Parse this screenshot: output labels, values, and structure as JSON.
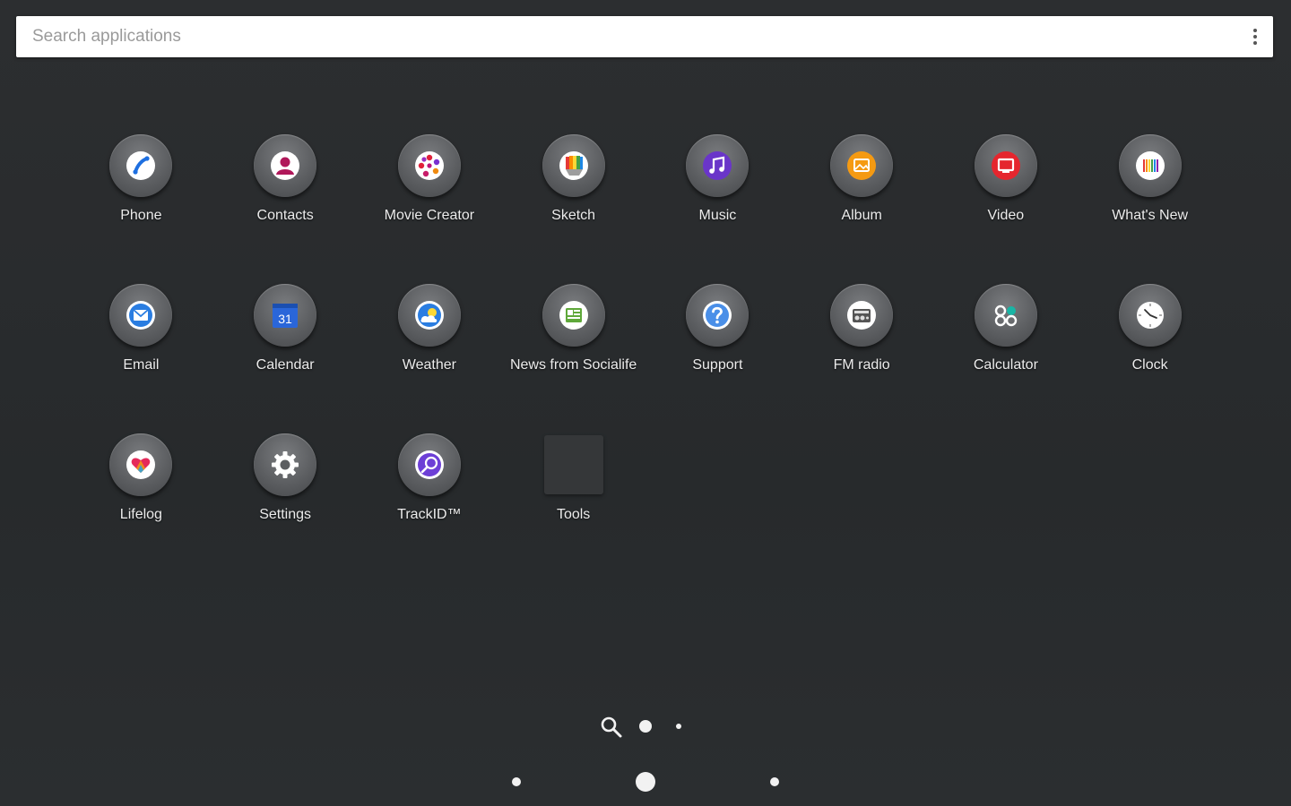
{
  "search": {
    "placeholder": "Search applications"
  },
  "apps": [
    {
      "label": "Phone",
      "icon": "phone-icon"
    },
    {
      "label": "Contacts",
      "icon": "contacts-icon"
    },
    {
      "label": "Movie Creator",
      "icon": "movie-creator-icon"
    },
    {
      "label": "Sketch",
      "icon": "sketch-icon"
    },
    {
      "label": "Music",
      "icon": "music-icon"
    },
    {
      "label": "Album",
      "icon": "album-icon"
    },
    {
      "label": "Video",
      "icon": "video-icon"
    },
    {
      "label": "What's New",
      "icon": "whats-new-icon"
    },
    {
      "label": "Email",
      "icon": "email-icon"
    },
    {
      "label": "Calendar",
      "icon": "calendar-icon",
      "date": "31"
    },
    {
      "label": "Weather",
      "icon": "weather-icon"
    },
    {
      "label": "News from Socialife",
      "icon": "news-icon"
    },
    {
      "label": "Support",
      "icon": "support-icon"
    },
    {
      "label": "FM radio",
      "icon": "fm-radio-icon"
    },
    {
      "label": "Calculator",
      "icon": "calculator-icon"
    },
    {
      "label": "Clock",
      "icon": "clock-icon"
    },
    {
      "label": "Lifelog",
      "icon": "lifelog-icon"
    },
    {
      "label": "Settings",
      "icon": "settings-icon"
    },
    {
      "label": "TrackID™",
      "icon": "trackid-icon"
    },
    {
      "label": "Tools",
      "icon": "folder-icon"
    }
  ],
  "pager": {
    "page_count": 2,
    "current_page": 1
  },
  "colors": {
    "background": "#2a2c2e",
    "search_bar": "#ffffff",
    "label": "#ececec"
  }
}
